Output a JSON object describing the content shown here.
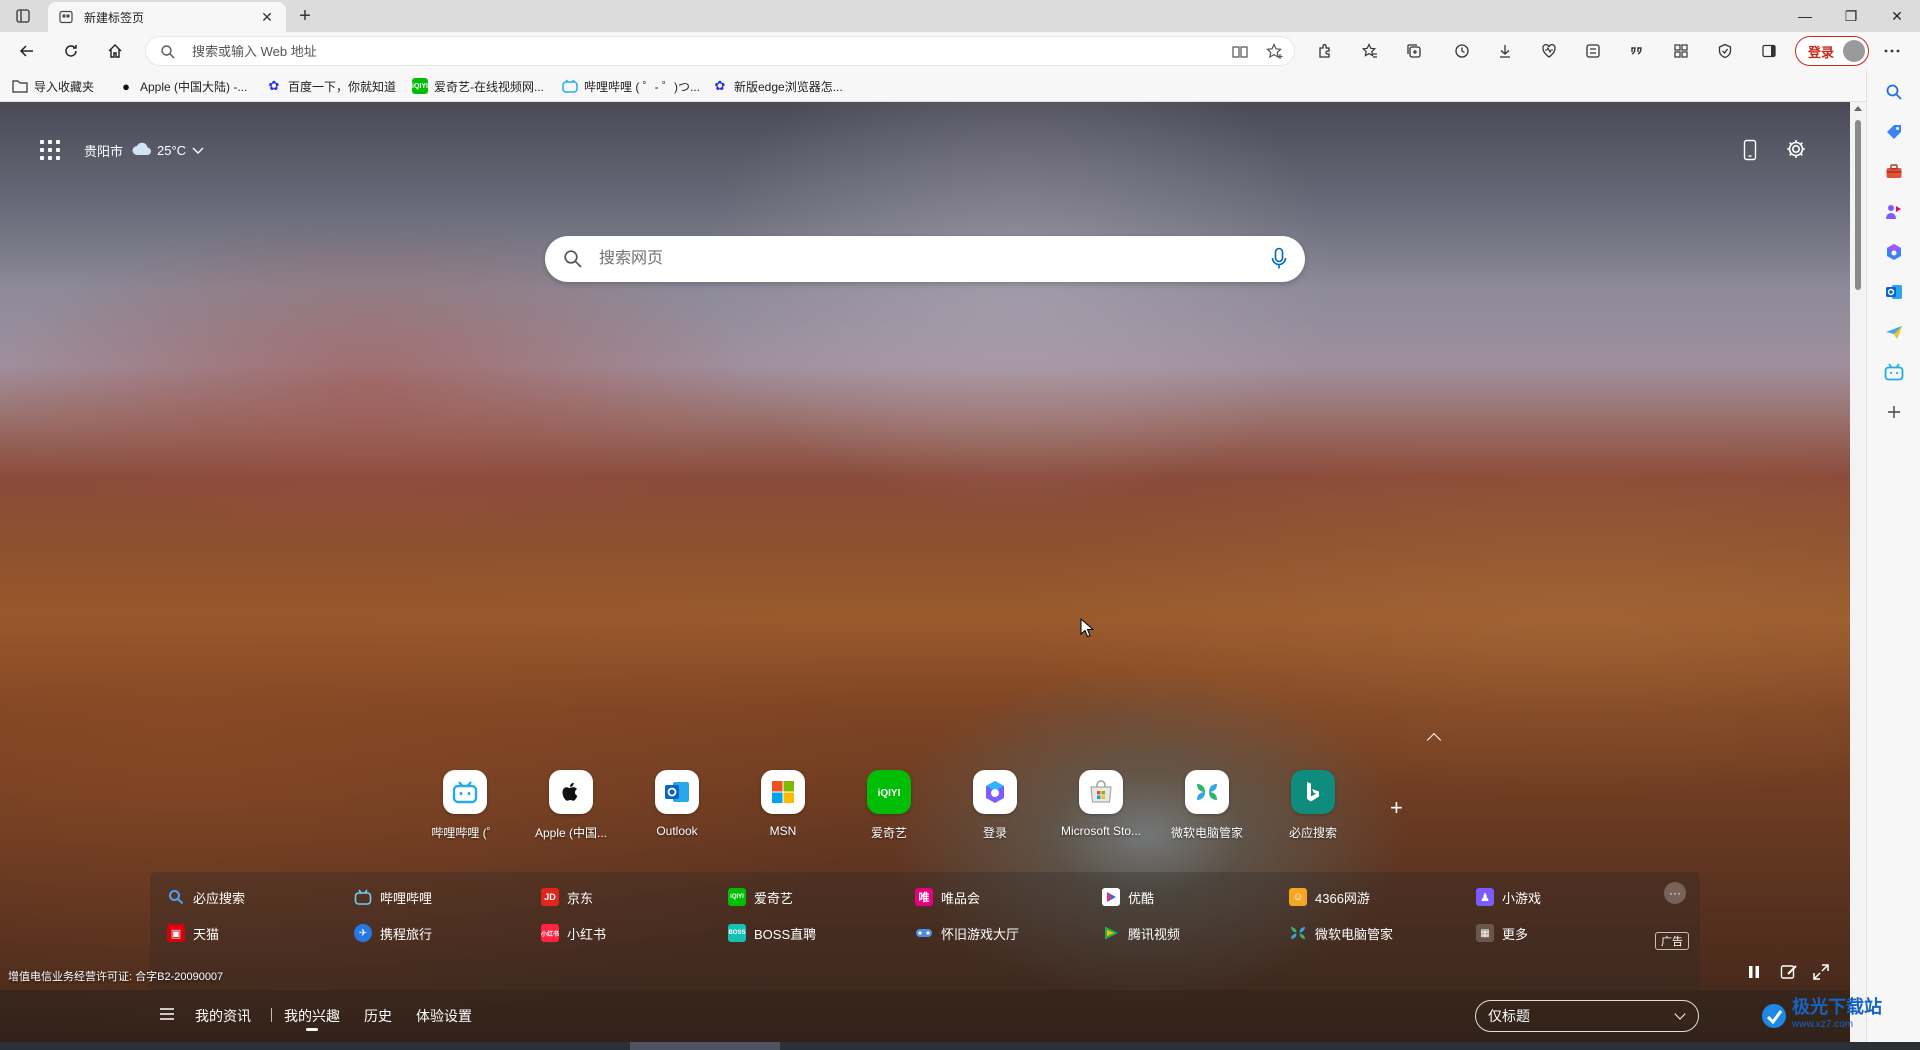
{
  "tab": {
    "title": "新建标签页",
    "close": "✕",
    "new": "+"
  },
  "window": {
    "minimize": "—",
    "restore": "❐",
    "close": "✕"
  },
  "address": {
    "placeholder": "搜索或输入 Web 地址",
    "value": ""
  },
  "login": {
    "label": "登录"
  },
  "favorites": [
    {
      "label": "导入收藏夹",
      "icon": "folder-import-icon"
    },
    {
      "label": "Apple (中国大陆) -...",
      "icon": "apple-icon"
    },
    {
      "label": "百度一下，你就知道",
      "icon": "baidu-icon"
    },
    {
      "label": "爱奇艺-在线视频网...",
      "icon": "iqiyi-icon"
    },
    {
      "label": "哔哩哔哩 ( ゜- ゜)つ...",
      "icon": "bilibili-icon"
    },
    {
      "label": "新版edge浏览器怎...",
      "icon": "baidu-icon"
    }
  ],
  "weather": {
    "city": "贵阳市",
    "temp": "25°C"
  },
  "search": {
    "placeholder": "搜索网页"
  },
  "quicklinks": [
    {
      "label": "哔哩哔哩 (゜",
      "icon": "bilibili-icon",
      "color": "#23ade5"
    },
    {
      "label": "Apple (中国...",
      "icon": "apple-icon",
      "color": "#000000"
    },
    {
      "label": "Outlook",
      "icon": "outlook-icon",
      "color": "#0a64c8"
    },
    {
      "label": "MSN",
      "icon": "msn-icon",
      "color": "#f25022"
    },
    {
      "label": "爱奇艺",
      "icon": "iqiyi-icon",
      "color": "#00be06"
    },
    {
      "label": "登录",
      "icon": "copilot-icon",
      "color": "#7a5cff"
    },
    {
      "label": "Microsoft Sto...",
      "icon": "store-icon",
      "color": "#0078d4"
    },
    {
      "label": "微软电脑管家",
      "icon": "pc-manager-icon",
      "color": "#2fb36f"
    },
    {
      "label": "必应搜索",
      "icon": "bing-icon",
      "color": "#0f8c7d"
    }
  ],
  "sites": {
    "row1": [
      {
        "label": "必应搜索",
        "color": "#2f7de1"
      },
      {
        "label": "哔哩哔哩",
        "color": "#23ade5"
      },
      {
        "label": "京东",
        "color": "#e1251b"
      },
      {
        "label": "爱奇艺",
        "color": "#00be06"
      },
      {
        "label": "唯品会",
        "color": "#e6007e"
      },
      {
        "label": "优酷",
        "color": "#1f6fff"
      },
      {
        "label": "4366网游",
        "color": "#f5a623"
      },
      {
        "label": "小游戏",
        "color": "#7b5cff"
      }
    ],
    "row2": [
      {
        "label": "天猫",
        "color": "#d6000f"
      },
      {
        "label": "携程旅行",
        "color": "#2577e3"
      },
      {
        "label": "小红书",
        "color": "#ff2442"
      },
      {
        "label": "BOSS直聘",
        "color": "#17c0b4"
      },
      {
        "label": "怀旧游戏大厅",
        "color": "#4a90e2"
      },
      {
        "label": "腾讯视频",
        "color": "#20b14a"
      },
      {
        "label": "微软电脑管家",
        "color": "#2fb36f"
      },
      {
        "label": "更多",
        "color": "#8a8a8a"
      }
    ],
    "more_dots": "···",
    "ad": "广告"
  },
  "license": "增值电信业务经营许可证: 合字B2-20090007",
  "bottomnav": {
    "items": [
      "我的资讯",
      "我的兴趣",
      "历史",
      "体验设置"
    ],
    "active": "我的兴趣",
    "dropdown": "仅标题"
  },
  "watermark": {
    "title": "极光下载站",
    "sub": "www.xz7.com"
  },
  "accent": "#c42b1c"
}
